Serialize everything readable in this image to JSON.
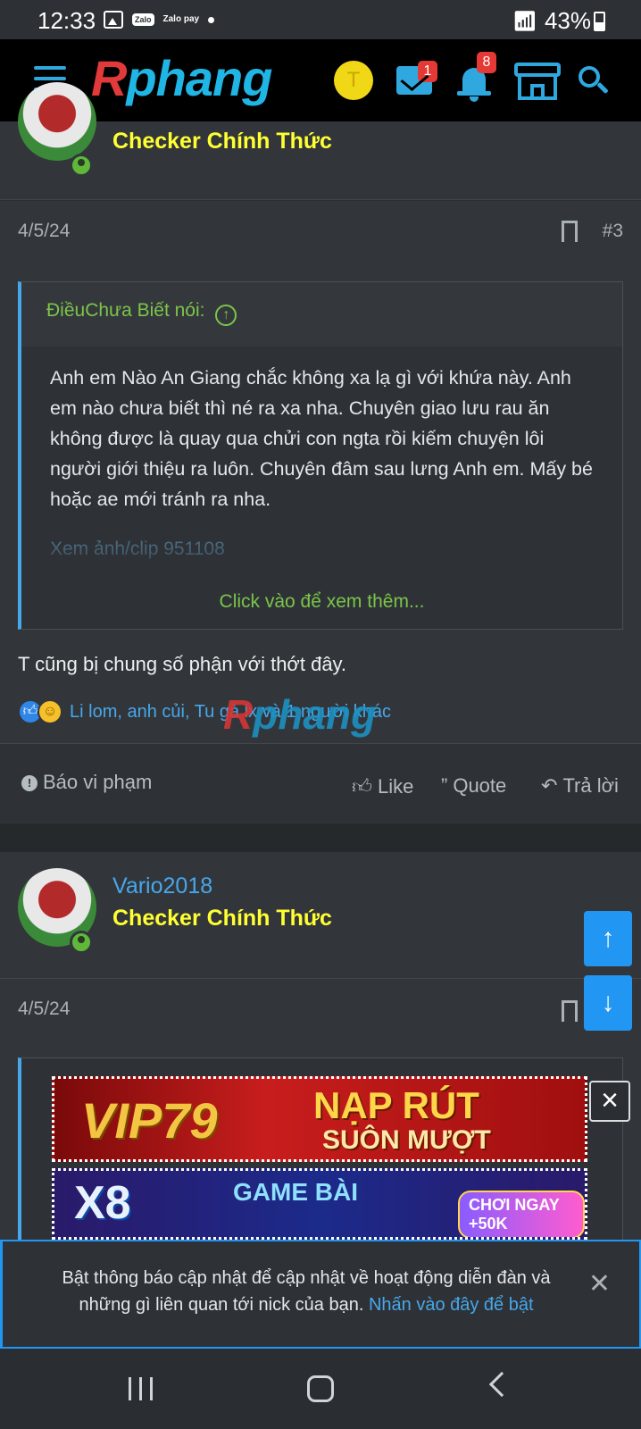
{
  "status_bar": {
    "time": "12:33",
    "zalo_label": "Zalo",
    "zalopay_label": "Zalo pay",
    "battery": "43%"
  },
  "header": {
    "logo_r": "R",
    "logo_rest": "phang",
    "user_initial": "T",
    "messages_badge": "1",
    "alerts_badge": "8"
  },
  "post1": {
    "user_title": "Checker Chính Thức",
    "date": "4/5/24",
    "number": "#3",
    "quote_author": "ĐiềuChưa Biết nói:",
    "quote_text": "Anh em Nào An Giang chắc không xa lạ gì với khứa này. Anh em nào chưa biết thì né ra xa nha. Chuyên giao lưu rau ăn không được là quay qua chửi con ngta rồi kiếm chuyện lôi người giới thiệu ra luôn. Chuyên đâm sau lưng Anh em. Mấy bé hoặc ae mới tránh ra nha.",
    "quote_link": "Xem ảnh/clip 951108",
    "quote_more": "Click vào để xem thêm...",
    "text": "T cũng bị chung số phận với thớt đây.",
    "reaction_names": "Li lom, anh củi, Tu gà lx và 1 người khác"
  },
  "actions": {
    "report": "Báo vi phạm",
    "like": "Like",
    "quote": "Quote",
    "reply": "Trả lời"
  },
  "post2": {
    "username": "Vario2018",
    "user_title": "Checker Chính Thức",
    "date": "4/5/24"
  },
  "ads": {
    "ad1_brand": "VIP79",
    "ad1_line1": "NẠP RÚT",
    "ad1_line2": "SUÔN MƯỢT",
    "ad2_brand": "X8",
    "ad2_line1": "GAME BÀI",
    "ad2_cta": "CHƠI NGAY +50K"
  },
  "notification": {
    "text": "Bật thông báo cập nhật để cập nhật về hoạt động diễn đàn và những gì liên quan tới nick của bạn.",
    "link": "Nhấn vào đây để bật"
  },
  "colors": {
    "accent": "#47a7eb",
    "user_title": "#ffff33",
    "quote_green": "#7bc54a",
    "fab_blue": "#2196f3"
  }
}
